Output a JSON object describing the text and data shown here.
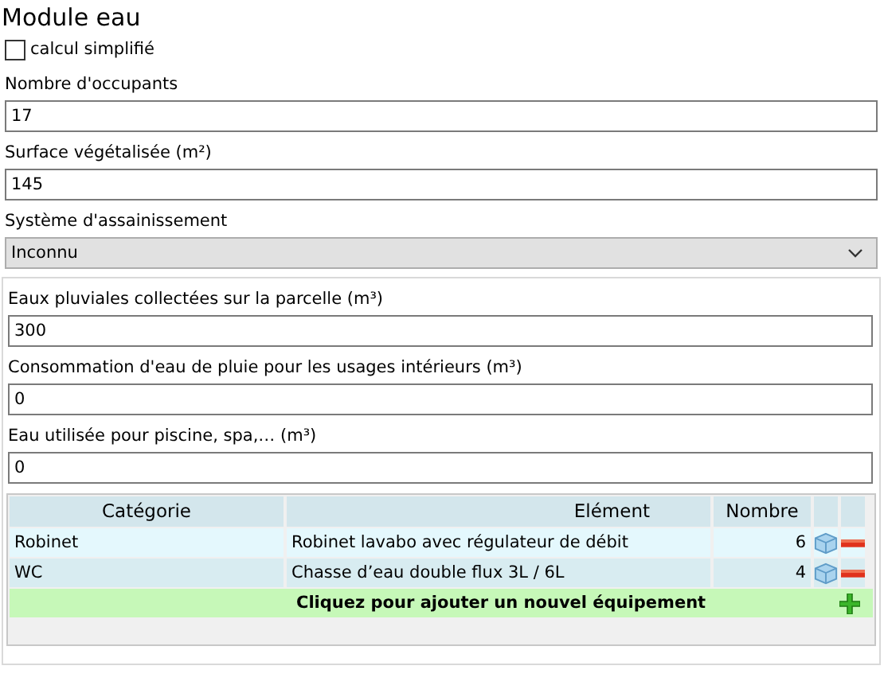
{
  "title": "Module eau",
  "simplified": {
    "label": "calcul simplifié",
    "checked": false
  },
  "fields": [
    {
      "label": "Nombre d'occupants",
      "value": "17"
    },
    {
      "label": "Surface végétalisée (m²)",
      "value": "145"
    }
  ],
  "sanitation": {
    "label": "Système d'assainissement",
    "value": "Inconnu"
  },
  "panel_fields": [
    {
      "label": "Eaux pluviales collectées sur la parcelle (m³)",
      "value": "300"
    },
    {
      "label": "Consommation d'eau de pluie pour les usages intérieurs (m³)",
      "value": "0"
    },
    {
      "label": "Eau utilisée pour piscine, spa,… (m³)",
      "value": "0"
    }
  ],
  "table": {
    "columns": [
      "Catégorie",
      "Elément",
      "Nombre"
    ],
    "rows": [
      {
        "category": "Robinet",
        "element": "Robinet lavabo avec régulateur de débit",
        "count": "6"
      },
      {
        "category": "WC",
        "element": "Chasse d’eau double flux 3L / 6L",
        "count": "4"
      }
    ],
    "add_row": "Cliquez pour ajouter un nouvel équipement"
  }
}
